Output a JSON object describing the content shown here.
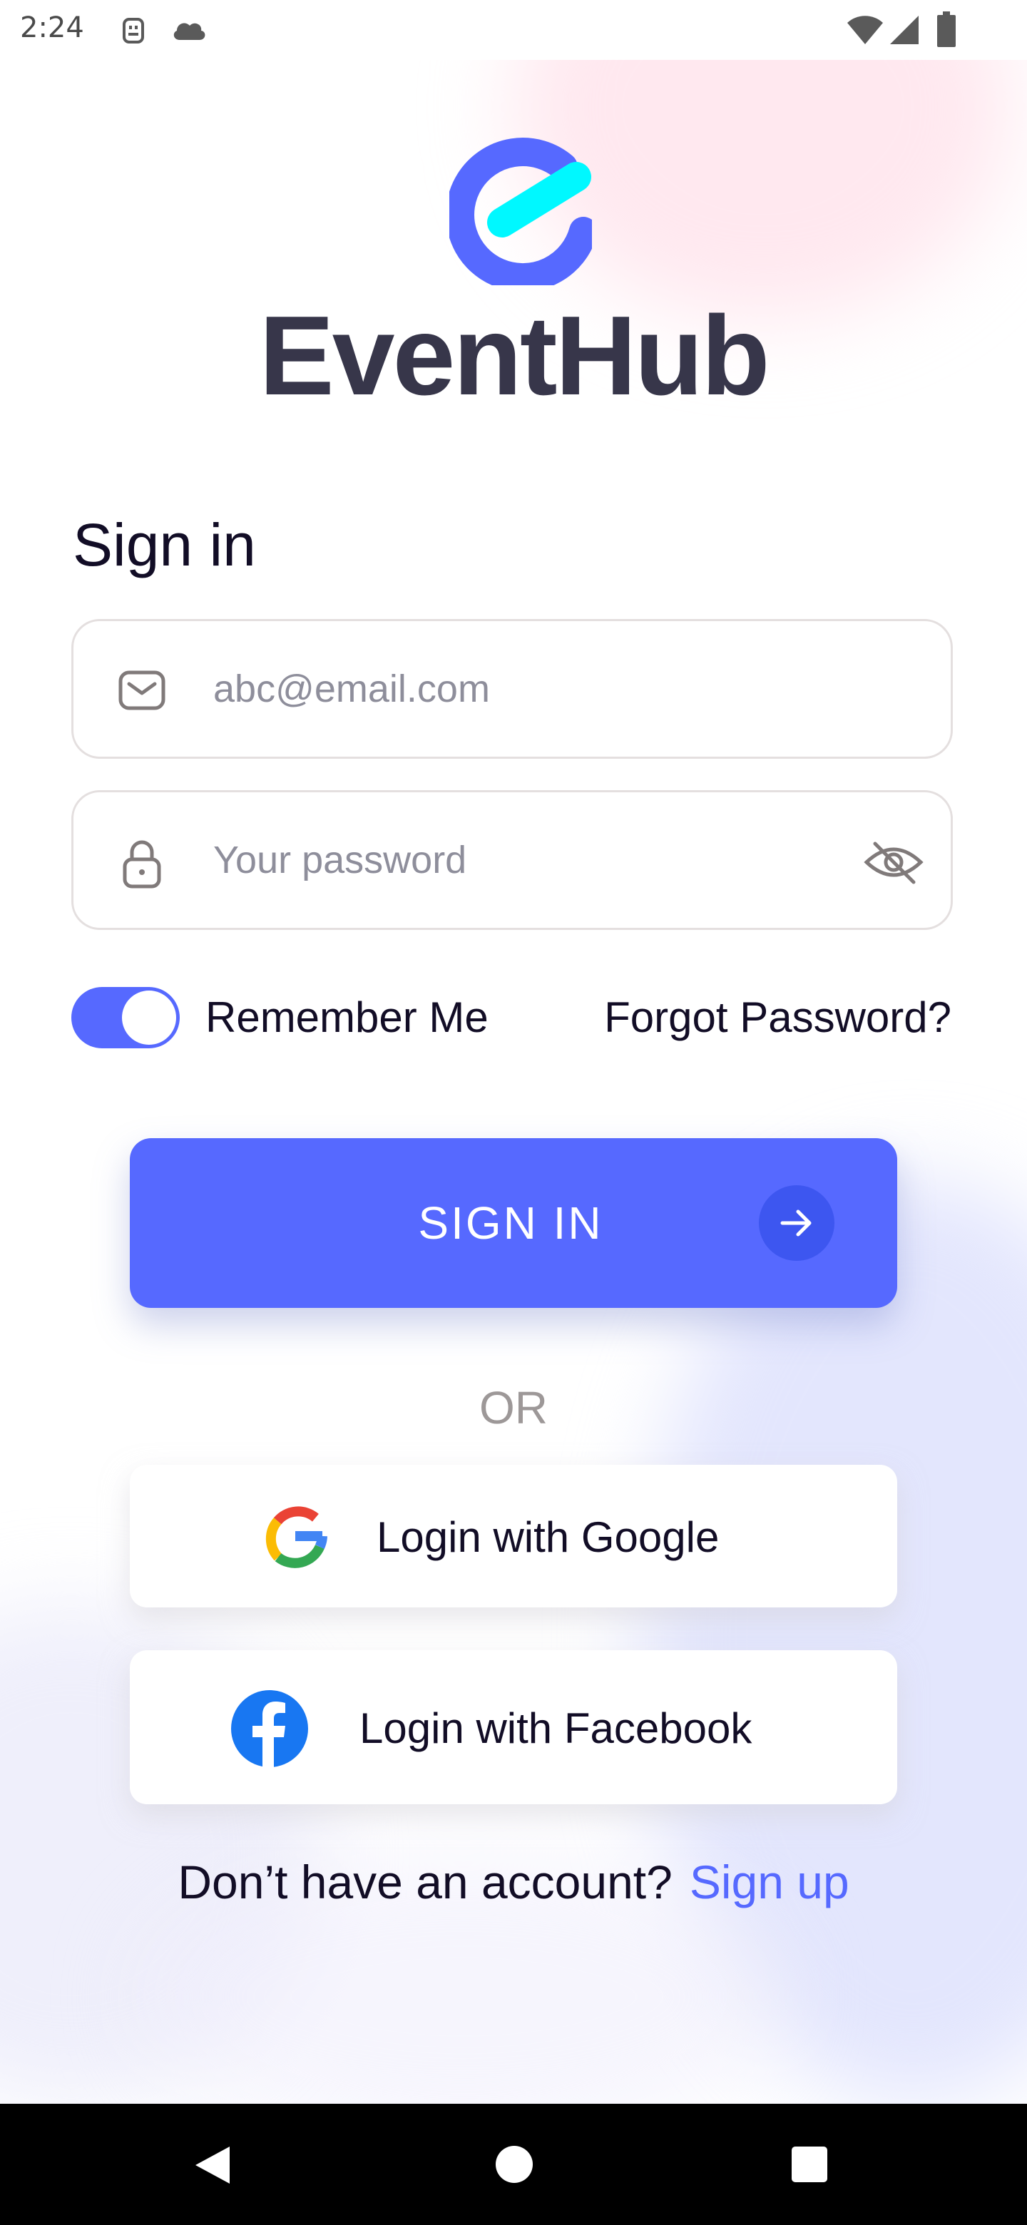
{
  "status_bar": {
    "time": "2:24"
  },
  "brand": {
    "name": "EventHub",
    "primary_color": "#5669FF",
    "accent_color": "#00F8FF"
  },
  "form": {
    "title": "Sign in",
    "email_placeholder": "abc@email.com",
    "password_placeholder": "Your password",
    "remember_label": "Remember Me",
    "remember_on": true,
    "forgot_label": "Forgot Password?",
    "submit_label": "SIGN IN"
  },
  "divider": {
    "label": "OR"
  },
  "social": {
    "google_label": "Login with Google",
    "facebook_label": "Login with Facebook"
  },
  "footer": {
    "prompt": "Don’t have an account?",
    "signup_label": "Sign up"
  },
  "icons": {
    "email": "mail-icon",
    "password": "lock-icon",
    "visibility": "eye-off-icon",
    "submit": "arrow-right-icon",
    "google": "google-icon",
    "facebook": "facebook-icon"
  }
}
